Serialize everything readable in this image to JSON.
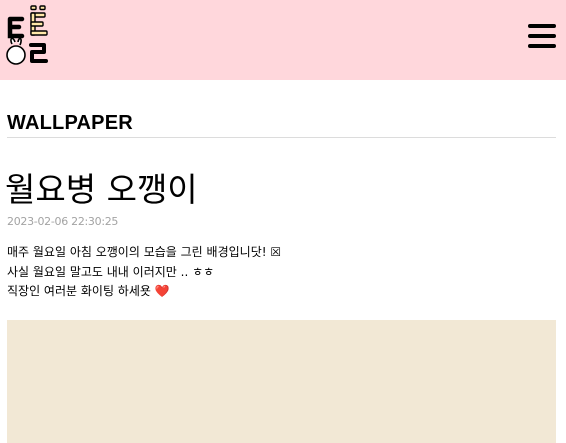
{
  "header": {
    "logo_text": "티블",
    "logo_color": "#ffe8a8",
    "background": "#ffd7dc",
    "menu_icon": "hamburger-menu-icon"
  },
  "category": {
    "label": "WALLPAPER"
  },
  "post": {
    "title": "월요병 오깽이",
    "date": "2023-02-06 22:30:25",
    "lines": [
      "매주 월요일 아침 오깽이의 모습을 그린 배경입니닷! ☒",
      "사실 월요일 말고도 내내 이러지만 .. ㅎㅎ",
      "직장인 여러분 화이팅 하세욧"
    ],
    "heart": "❤️",
    "image_background": "#f2e8d5"
  }
}
